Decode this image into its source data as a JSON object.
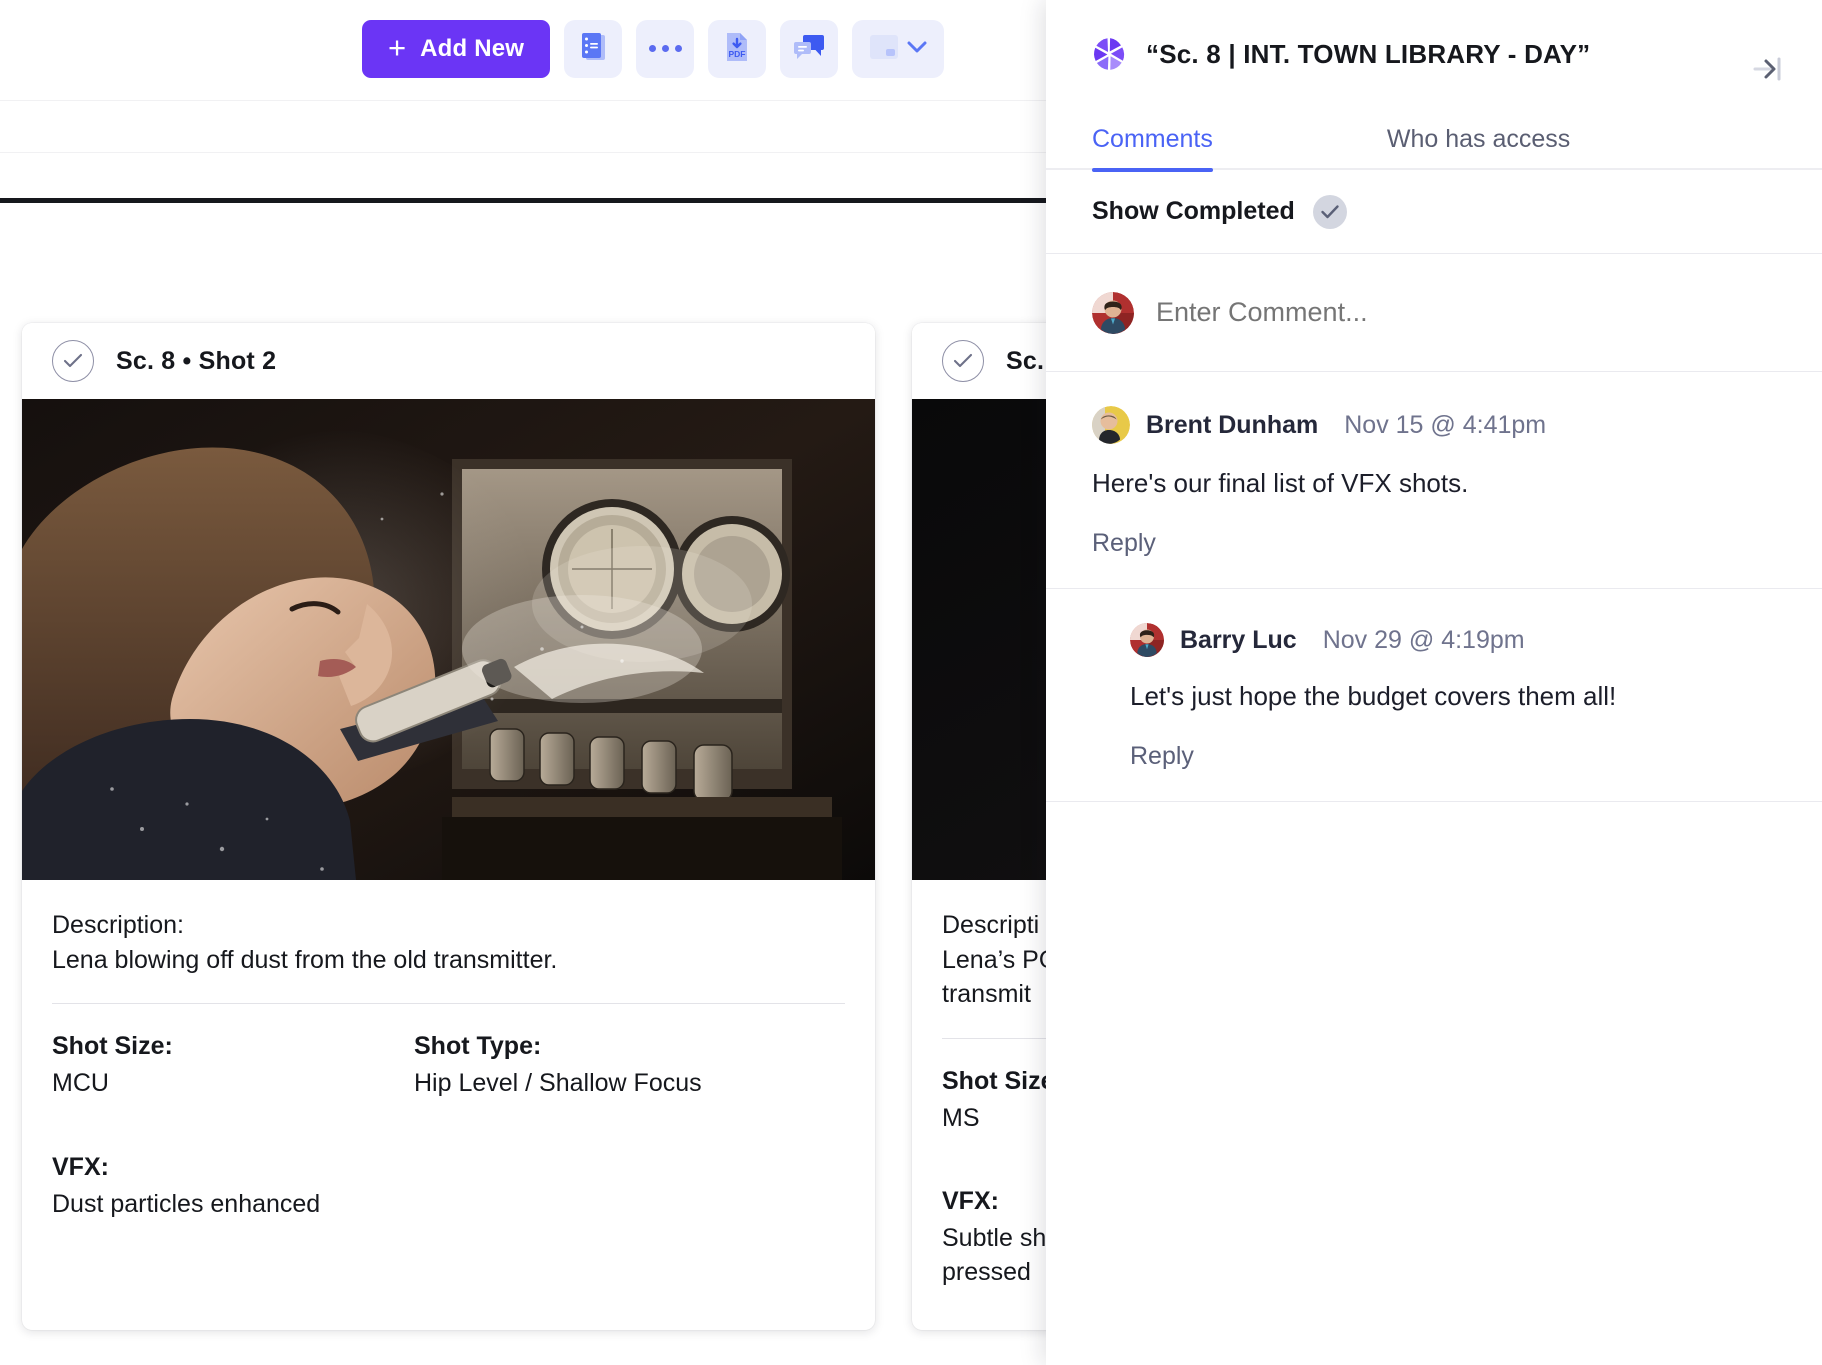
{
  "toolbar": {
    "add_new_label": "Add New",
    "plus_glyph": "+",
    "buttons": [
      {
        "name": "shot-list-icon",
        "tooltip": "Shot List"
      },
      {
        "name": "more-options-icon",
        "tooltip": "More"
      },
      {
        "name": "download-pdf-icon",
        "tooltip": "Download PDF"
      },
      {
        "name": "comments-icon",
        "tooltip": "Comments"
      },
      {
        "name": "layout-view-icon",
        "tooltip": "Layout"
      }
    ]
  },
  "cards": [
    {
      "title": "Sc. 8  •  Shot  2",
      "completed": true,
      "description_label": "Description:",
      "description": "Lena blowing off dust from the old transmitter.",
      "shot_size_label": "Shot Size:",
      "shot_size": "MCU",
      "shot_type_label": "Shot Type:",
      "shot_type": "Hip Level / Shallow Focus",
      "vfx_label": "VFX:",
      "vfx": "Dust particles enhanced"
    },
    {
      "title": "Sc.",
      "completed": true,
      "description_label": "Descripti",
      "description": "Lena’s PO\ntransmit",
      "shot_size_label": "Shot Size",
      "shot_size": "MS",
      "shot_type_label": "",
      "shot_type": "",
      "vfx_label": "VFX:",
      "vfx": "Subtle sh\npressed"
    }
  ],
  "panel": {
    "title": "“Sc. 8 | INT. TOWN LIBRARY - DAY”",
    "collapse_icon": "collapse-panel-icon",
    "aperture_icon": "aperture-icon",
    "tabs": [
      {
        "label": "Comments",
        "active": true
      },
      {
        "label": "Who has access",
        "active": false
      }
    ],
    "show_completed_label": "Show Completed",
    "show_completed_checked": true,
    "comment_placeholder": "Enter Comment...",
    "comments": [
      {
        "author": "Brent Dunham",
        "time": "Nov 15 @ 4:41pm",
        "body": "Here's our final list of VFX shots.",
        "reply_label": "Reply",
        "is_reply": false
      },
      {
        "author": "Barry Luc",
        "time": "Nov 29 @ 4:19pm",
        "body": "Let's just hope the budget covers them all!",
        "reply_label": "Reply",
        "is_reply": true
      }
    ]
  },
  "colors": {
    "accent_purple": "#6B35F5",
    "accent_blue": "#4A63F5",
    "tool_bg": "#EDEFFC",
    "rule_dark": "#16181D"
  }
}
